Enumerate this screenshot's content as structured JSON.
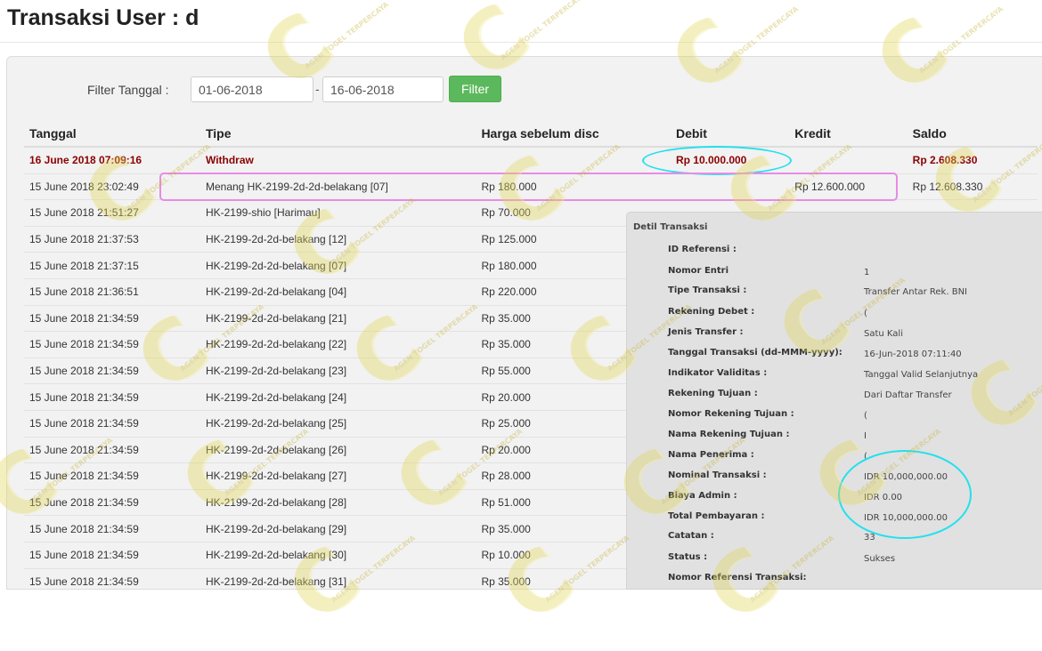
{
  "page": {
    "title": "Transaksi User : d"
  },
  "filter": {
    "label": "Filter Tanggal :",
    "date_from": "01-06-2018",
    "separator": "-",
    "date_to": "16-06-2018",
    "button_label": "Filter"
  },
  "table": {
    "headers": [
      "Tanggal",
      "Tipe",
      "Harga sebelum disc",
      "Debit",
      "Kredit",
      "Saldo"
    ],
    "rows": [
      {
        "date": "16 June 2018 07:09:16",
        "type": "Withdraw",
        "price": "",
        "debit": "Rp 10.000.000",
        "credit": "",
        "saldo": "Rp 2.608.330"
      },
      {
        "date": "15 June 2018 23:02:49",
        "type": "Menang HK-2199-2d-2d-belakang [07]",
        "price": "Rp 180.000",
        "debit": "",
        "credit": "Rp 12.600.000",
        "saldo": "Rp 12.608.330"
      },
      {
        "date": "15 June 2018 21:51:27",
        "type": "HK-2199-shio [Harimau]",
        "price": "Rp 70.000",
        "debit": "",
        "credit": "",
        "saldo": ""
      },
      {
        "date": "15 June 2018 21:37:53",
        "type": "HK-2199-2d-2d-belakang [12]",
        "price": "Rp 125.000",
        "debit": "",
        "credit": "",
        "saldo": ""
      },
      {
        "date": "15 June 2018 21:37:15",
        "type": "HK-2199-2d-2d-belakang [07]",
        "price": "Rp 180.000",
        "debit": "",
        "credit": "",
        "saldo": ""
      },
      {
        "date": "15 June 2018 21:36:51",
        "type": "HK-2199-2d-2d-belakang [04]",
        "price": "Rp 220.000",
        "debit": "",
        "credit": "",
        "saldo": ""
      },
      {
        "date": "15 June 2018 21:34:59",
        "type": "HK-2199-2d-2d-belakang [21]",
        "price": "Rp 35.000",
        "debit": "",
        "credit": "",
        "saldo": ""
      },
      {
        "date": "15 June 2018 21:34:59",
        "type": "HK-2199-2d-2d-belakang [22]",
        "price": "Rp 35.000",
        "debit": "",
        "credit": "",
        "saldo": ""
      },
      {
        "date": "15 June 2018 21:34:59",
        "type": "HK-2199-2d-2d-belakang [23]",
        "price": "Rp 55.000",
        "debit": "",
        "credit": "",
        "saldo": ""
      },
      {
        "date": "15 June 2018 21:34:59",
        "type": "HK-2199-2d-2d-belakang [24]",
        "price": "Rp 20.000",
        "debit": "",
        "credit": "",
        "saldo": ""
      },
      {
        "date": "15 June 2018 21:34:59",
        "type": "HK-2199-2d-2d-belakang [25]",
        "price": "Rp 25.000",
        "debit": "",
        "credit": "",
        "saldo": ""
      },
      {
        "date": "15 June 2018 21:34:59",
        "type": "HK-2199-2d-2d-belakang [26]",
        "price": "Rp 20.000",
        "debit": "",
        "credit": "",
        "saldo": ""
      },
      {
        "date": "15 June 2018 21:34:59",
        "type": "HK-2199-2d-2d-belakang [27]",
        "price": "Rp 28.000",
        "debit": "",
        "credit": "",
        "saldo": ""
      },
      {
        "date": "15 June 2018 21:34:59",
        "type": "HK-2199-2d-2d-belakang [28]",
        "price": "Rp 51.000",
        "debit": "",
        "credit": "",
        "saldo": ""
      },
      {
        "date": "15 June 2018 21:34:59",
        "type": "HK-2199-2d-2d-belakang [29]",
        "price": "Rp 35.000",
        "debit": "",
        "credit": "",
        "saldo": ""
      },
      {
        "date": "15 June 2018 21:34:59",
        "type": "HK-2199-2d-2d-belakang [30]",
        "price": "Rp 10.000",
        "debit": "",
        "credit": "",
        "saldo": ""
      },
      {
        "date": "15 June 2018 21:34:59",
        "type": "HK-2199-2d-2d-belakang [31]",
        "price": "Rp 35.000",
        "debit": "",
        "credit": "",
        "saldo": ""
      }
    ]
  },
  "detail": {
    "title": "Detil Transaksi",
    "rows": [
      {
        "label": "ID Referensi :",
        "value": ""
      },
      {
        "label": "Nomor Entri",
        "value": "1"
      },
      {
        "label": "Tipe Transaksi :",
        "value": "Transfer Antar Rek. BNI"
      },
      {
        "label": "Rekening Debet :",
        "value": "("
      },
      {
        "label": "Jenis Transfer :",
        "value": "Satu Kali"
      },
      {
        "label": "Tanggal Transaksi (dd-MMM-yyyy):",
        "value": "16-Jun-2018 07:11:40"
      },
      {
        "label": "Indikator Validitas :",
        "value": "Tanggal Valid Selanjutnya"
      },
      {
        "label": "Rekening Tujuan :",
        "value": "Dari Daftar Transfer"
      },
      {
        "label": "Nomor Rekening Tujuan :",
        "value": "("
      },
      {
        "label": "Nama Rekening Tujuan :",
        "value": "I"
      },
      {
        "label": "Nama Penerima :",
        "value": "("
      },
      {
        "label": "Nominal Transaksi :",
        "value": "IDR 10,000,000.00"
      },
      {
        "label": "Biaya Admin :",
        "value": "IDR 0.00"
      },
      {
        "label": "Total Pembayaran :",
        "value": "IDR 10,000,000.00"
      },
      {
        "label": "Catatan :",
        "value": "33"
      },
      {
        "label": "Status :",
        "value": "Sukses"
      },
      {
        "label": "Nomor Referensi Transaksi:",
        "value": ""
      }
    ]
  },
  "watermark": {
    "glyph": "C",
    "text": "AGEN TOGEL TERPERCAYA"
  },
  "colors": {
    "accent_button": "#5cb85c",
    "withdraw_text": "#8b0000",
    "marker_cyan": "#22e0ee",
    "marker_pink": "#e88be6"
  }
}
